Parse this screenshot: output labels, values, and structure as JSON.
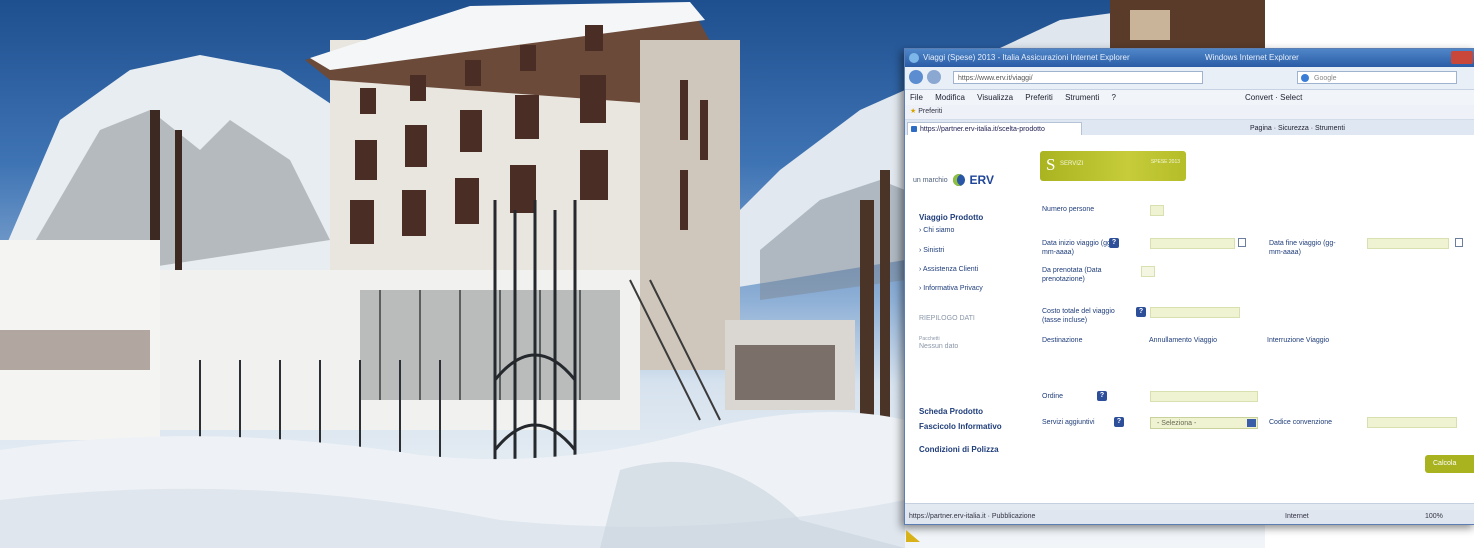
{
  "browser": {
    "title": "Viaggi (Spese) 2013 - Italia Assicurazioni Internet Explorer",
    "title_right": "Windows Internet Explorer",
    "url": "https://www.erv.it/viaggi/",
    "search_placeholder": "Google",
    "menu": [
      "File",
      "Modifica",
      "Visualizza",
      "Preferiti",
      "Strumenti",
      "?"
    ],
    "menu_right": "Convert · Select",
    "favorites": "Preferiti",
    "tab_title": "https://partner.erv-italia.it/scelta-prodotto",
    "tools": "Pagina · Sicurezza · Strumenti",
    "status_left": "https://partner.erv-italia.it · Pubblicazione",
    "status_zone": "Internet",
    "status_zoom": "100%"
  },
  "brand": {
    "logo_prefix": "un marchio",
    "logo_name": "ERV",
    "banner_letter": "S",
    "banner_text": "SERVIZI",
    "banner_side": "SPESE 2013"
  },
  "sidebar": {
    "title": "Viaggio Prodotto",
    "items": [
      "Chi siamo",
      "Sinistri",
      "Assistenza Clienti",
      "Informativa Privacy"
    ],
    "section": "RIEPILOGO DATI",
    "sub_caption": "Pacchetti",
    "sub_item": "Nessun dato",
    "bottom_items": [
      "Scheda Prodotto",
      "Fascicolo Informativo",
      "Condizioni di Polizza"
    ]
  },
  "form": {
    "label_persons": "Numero persone",
    "label_start": "Data inizio viaggio (gg-mm-aaaa)",
    "label_end": "Data fine viaggio (gg-mm-aaaa)",
    "label_booking": "Da prenotata (Data prenotazione)",
    "label_cost": "Costo totale del viaggio (tasse incluse)",
    "label_dest": "Destinazione",
    "dest_col1": "Annullamento Viaggio",
    "dest_col2": "Interruzione Viaggio",
    "label_order": "Ordine",
    "label_extra": "Servizi aggiuntivi",
    "select_value": "- Seleziona -",
    "label_extra2": "Codice convenzione",
    "submit": "Calcola"
  }
}
